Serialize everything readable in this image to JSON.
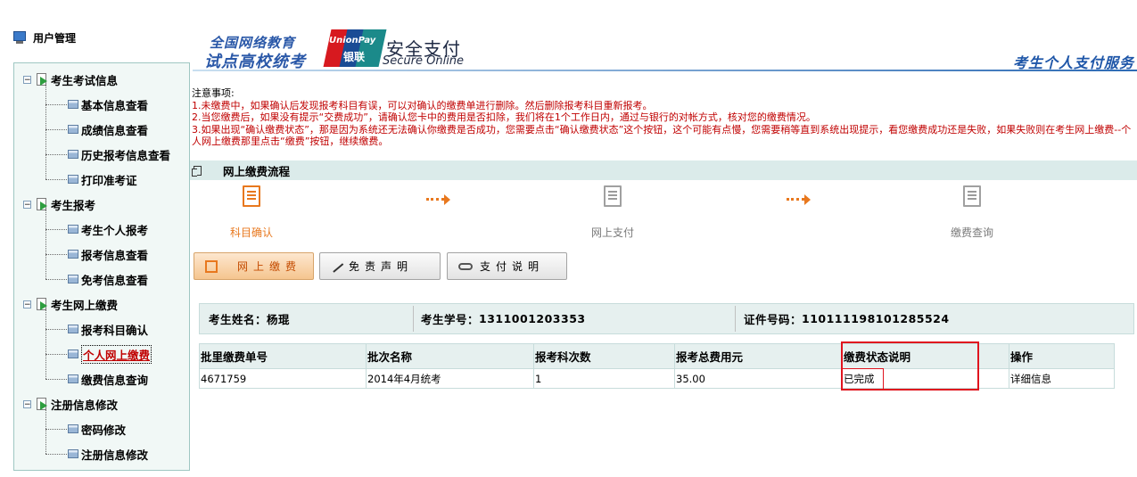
{
  "sidebar": {
    "title": "用户管理",
    "groups": [
      {
        "label": "考生考试信息",
        "toggle": "−",
        "items": [
          "基本信息查看",
          "成绩信息查看",
          "历史报考信息查看",
          "打印准考证"
        ]
      },
      {
        "label": "考生报考",
        "toggle": "−",
        "items": [
          "考生个人报考",
          "报考信息查看",
          "免考信息查看"
        ]
      },
      {
        "label": "考生网上缴费",
        "toggle": "−",
        "items": [
          "报考科目确认",
          "个人网上缴费",
          "缴费信息查询"
        ]
      },
      {
        "label": "注册信息修改",
        "toggle": "−",
        "items": [
          "密码修改",
          "注册信息修改"
        ]
      }
    ],
    "active_item": "个人网上缴费"
  },
  "header": {
    "brand_line1": "全国网络教育",
    "brand_line2": "试点高校统考",
    "unionpay_en": "UnionPay",
    "unionpay_cn": "银联",
    "secure_cn": "安全支付",
    "secure_en": "Secure Online",
    "service_title": "考生个人支付服务"
  },
  "notices": {
    "heading": "注意事项:",
    "items": [
      "1.未缴费中，如果确认后发现报考科目有误，可以对确认的缴费单进行删除。然后删除报考科目重新报考。",
      "2.当您缴费后，如果没有提示“交费成功”，请确认您卡中的费用是否扣除，我们将在1个工作日内，通过与银行的对帐方式，核对您的缴费情况。",
      "3.如果出现“确认缴费状态”，那是因为系统还无法确认你缴费是否成功，您需要点击“确认缴费状态”这个按钮，这个可能有点慢，您需要稍等直到系统出现提示，看您缴费成功还是失败，如果失败则在考生网上缴费--个人网上缴费那里点击“缴费”按钮，继续缴费。"
    ]
  },
  "process": {
    "title": "网上缴费流程",
    "steps": [
      "科目确认",
      "网上支付",
      "缴费查询"
    ]
  },
  "actions": {
    "pay": "网上缴费",
    "disclaimer": "免责声明",
    "help": "支付说明"
  },
  "student": {
    "name_label": "考生姓名：",
    "name": "杨琨",
    "id_label": "考生学号：",
    "id": "1311001203353",
    "cert_label": "证件号码：",
    "cert": "110111198101285524"
  },
  "table": {
    "columns": [
      "批里缴费单号",
      "批次名称",
      "报考科次数",
      "报考总费用元",
      "缴费状态说明",
      "操作"
    ],
    "rows": [
      [
        "4671759",
        "2014年4月统考",
        "1",
        "35.00",
        "已完成",
        "详细信息"
      ]
    ]
  },
  "colors": {
    "accent_orange": "#e8781e",
    "notice_red": "#c00000",
    "header_blue": "#1e56a8",
    "highlight_red": "#e0141e"
  }
}
